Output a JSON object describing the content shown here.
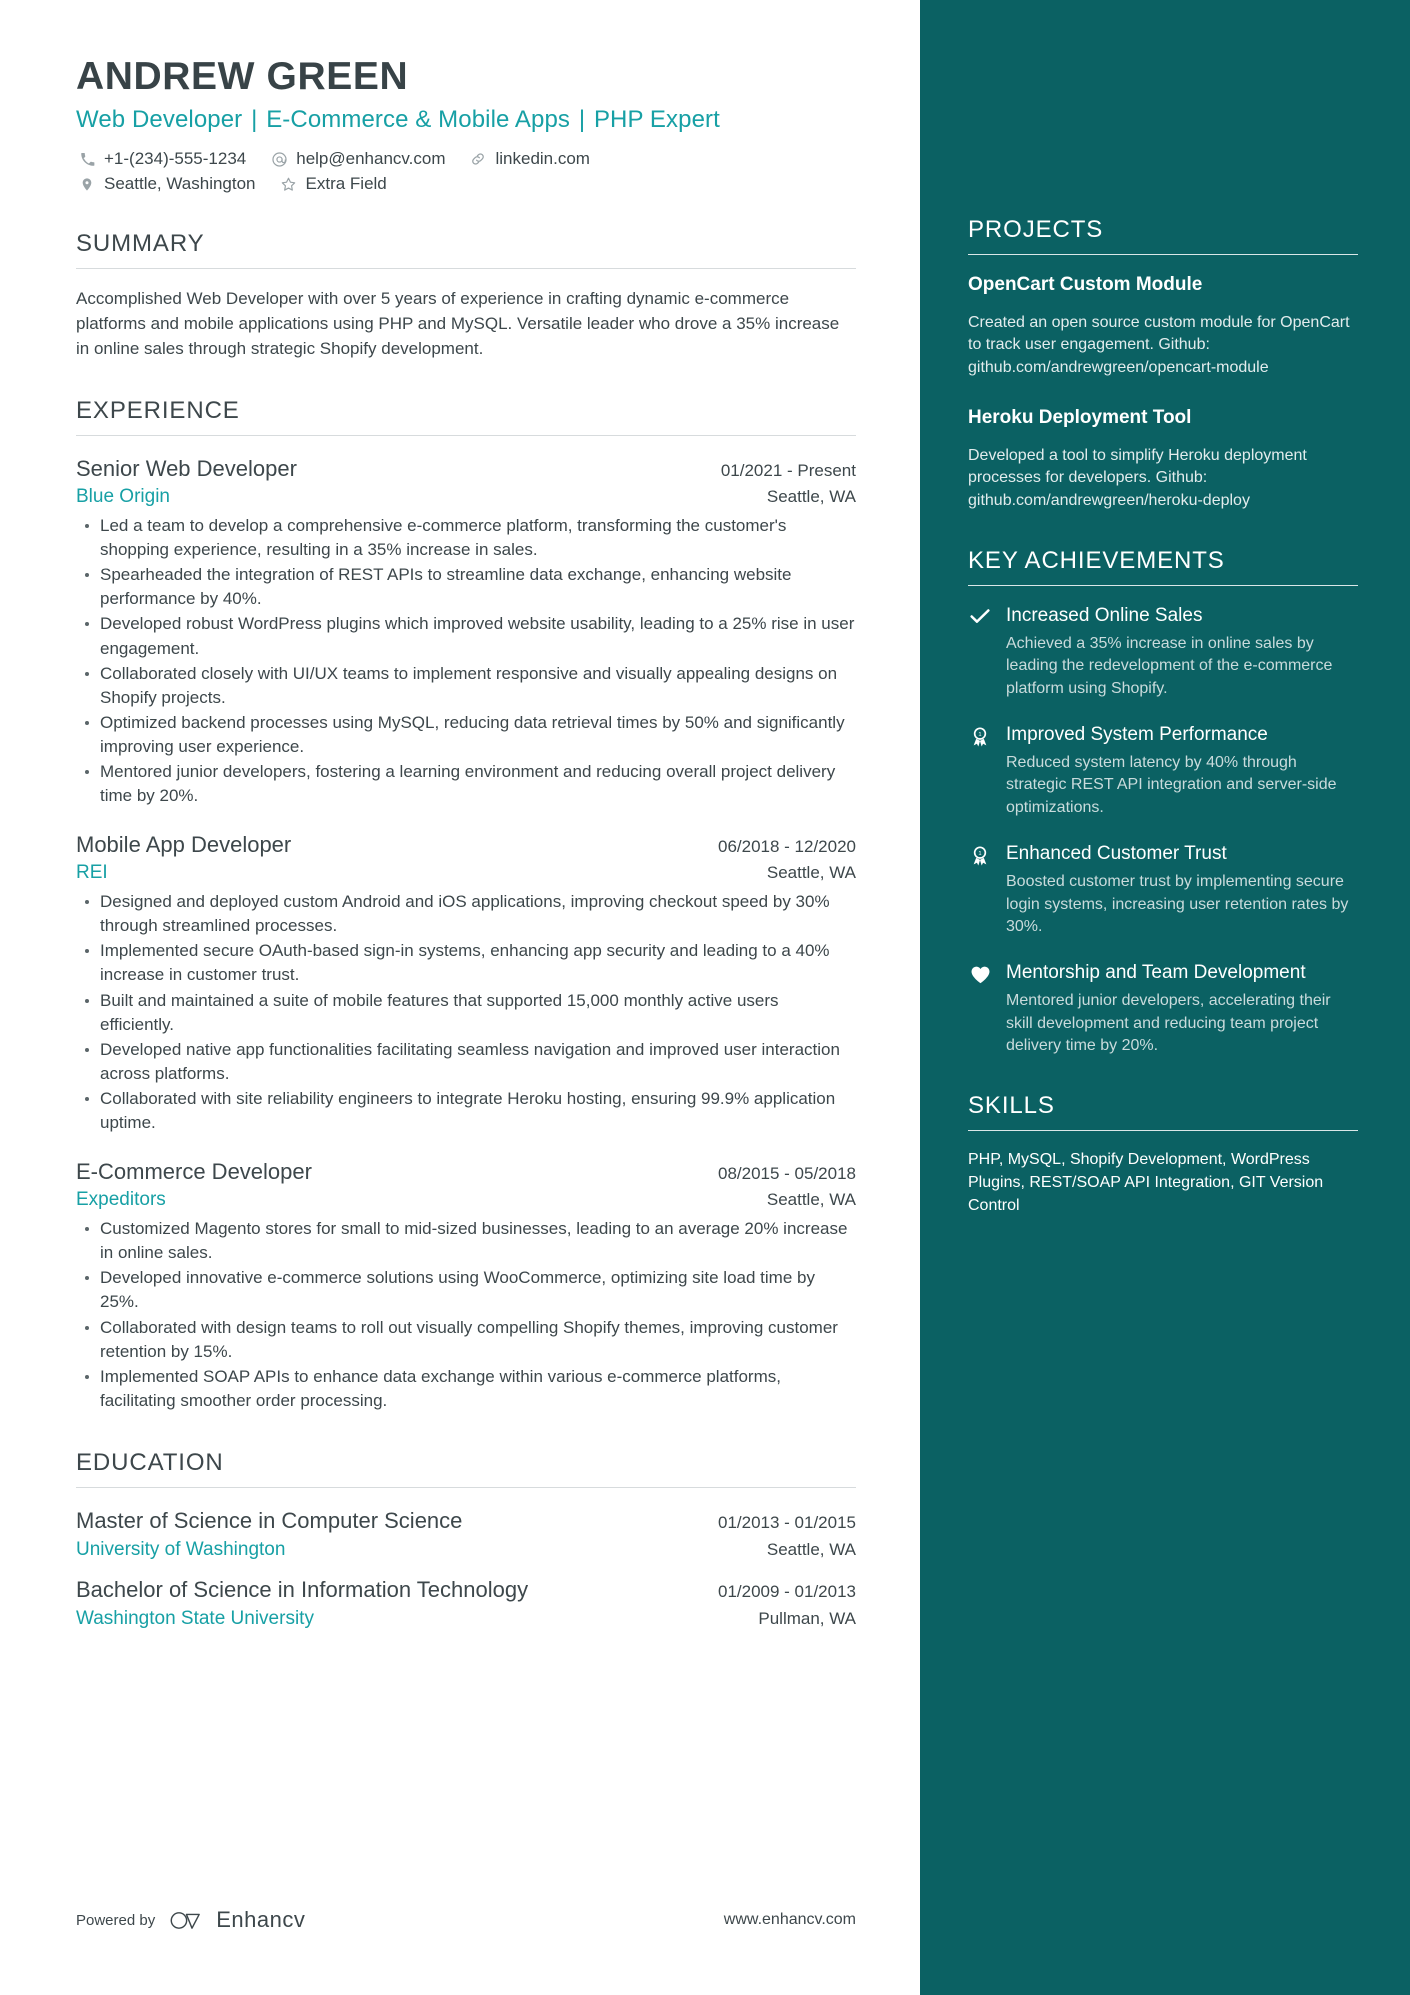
{
  "header": {
    "name": "ANDREW GREEN",
    "headline_parts": [
      "Web Developer",
      "E-Commerce & Mobile Apps",
      "PHP Expert"
    ],
    "separator": "|",
    "contacts_row1": [
      {
        "icon": "phone-icon",
        "text": "+1-(234)-555-1234"
      },
      {
        "icon": "email-icon",
        "text": "help@enhancv.com"
      },
      {
        "icon": "link-icon",
        "text": "linkedin.com"
      }
    ],
    "contacts_row2": [
      {
        "icon": "location-pin-icon",
        "text": "Seattle, Washington"
      },
      {
        "icon": "star-icon",
        "text": "Extra Field"
      }
    ]
  },
  "summary": {
    "title": "SUMMARY",
    "text": "Accomplished Web Developer with over 5 years of experience in crafting dynamic e-commerce platforms and mobile applications using PHP and MySQL. Versatile leader who drove a 35% increase in online sales through strategic Shopify development."
  },
  "experience": {
    "title": "EXPERIENCE",
    "jobs": [
      {
        "title": "Senior Web Developer",
        "dates": "01/2021 - Present",
        "company": "Blue Origin",
        "location": "Seattle, WA",
        "bullets": [
          "Led a team to develop a comprehensive e-commerce platform, transforming the customer's shopping experience, resulting in a 35% increase in sales.",
          "Spearheaded the integration of REST APIs to streamline data exchange, enhancing website performance by 40%.",
          "Developed robust WordPress plugins which improved website usability, leading to a 25% rise in user engagement.",
          "Collaborated closely with UI/UX teams to implement responsive and visually appealing designs on Shopify projects.",
          "Optimized backend processes using MySQL, reducing data retrieval times by 50% and significantly improving user experience.",
          "Mentored junior developers, fostering a learning environment and reducing overall project delivery time by 20%."
        ]
      },
      {
        "title": "Mobile App Developer",
        "dates": "06/2018 - 12/2020",
        "company": "REI",
        "location": "Seattle, WA",
        "bullets": [
          "Designed and deployed custom Android and iOS applications, improving checkout speed by 30% through streamlined processes.",
          "Implemented secure OAuth-based sign-in systems, enhancing app security and leading to a 40% increase in customer trust.",
          "Built and maintained a suite of mobile features that supported 15,000 monthly active users efficiently.",
          "Developed native app functionalities facilitating seamless navigation and improved user interaction across platforms.",
          "Collaborated with site reliability engineers to integrate Heroku hosting, ensuring 99.9% application uptime."
        ]
      },
      {
        "title": "E-Commerce Developer",
        "dates": "08/2015 - 05/2018",
        "company": "Expeditors",
        "location": "Seattle, WA",
        "bullets": [
          "Customized Magento stores for small to mid-sized businesses, leading to an average 20% increase in online sales.",
          "Developed innovative e-commerce solutions using WooCommerce, optimizing site load time by 25%.",
          "Collaborated with design teams to roll out visually compelling Shopify themes, improving customer retention by 15%.",
          "Implemented SOAP APIs to enhance data exchange within various e-commerce platforms, facilitating smoother order processing."
        ]
      }
    ]
  },
  "education": {
    "title": "EDUCATION",
    "entries": [
      {
        "degree": "Master of Science in Computer Science",
        "dates": "01/2013 - 01/2015",
        "school": "University of Washington",
        "location": "Seattle, WA"
      },
      {
        "degree": "Bachelor of Science in Information Technology",
        "dates": "01/2009 - 01/2013",
        "school": "Washington State University",
        "location": "Pullman, WA"
      }
    ]
  },
  "footer": {
    "powered_by": "Powered by",
    "brand": "Enhancv",
    "url": "www.enhancv.com"
  },
  "sidebar": {
    "projects": {
      "title": "PROJECTS",
      "items": [
        {
          "name": "OpenCart Custom Module",
          "description": "Created an open source custom module for OpenCart to track user engagement. Github: github.com/andrewgreen/opencart-module"
        },
        {
          "name": "Heroku Deployment Tool",
          "description": "Developed a tool to simplify Heroku deployment processes for developers. Github: github.com/andrewgreen/heroku-deploy"
        }
      ]
    },
    "achievements": {
      "title": "KEY ACHIEVEMENTS",
      "items": [
        {
          "icon": "check-icon",
          "title": "Increased Online Sales",
          "description": "Achieved a 35% increase in online sales by leading the redevelopment of the e-commerce platform using Shopify."
        },
        {
          "icon": "award-ribbon-icon",
          "title": "Improved System Performance",
          "description": "Reduced system latency by 40% through strategic REST API integration and server-side optimizations."
        },
        {
          "icon": "award-ribbon-icon",
          "title": "Enhanced Customer Trust",
          "description": "Boosted customer trust by implementing secure login systems, increasing user retention rates by 30%."
        },
        {
          "icon": "heart-icon",
          "title": "Mentorship and Team Development",
          "description": "Mentored junior developers, accelerating their skill development and reducing team project delivery time by 20%."
        }
      ]
    },
    "skills": {
      "title": "SKILLS",
      "text": "PHP, MySQL, Shopify Development, WordPress Plugins, REST/SOAP API Integration, GIT Version Control"
    }
  },
  "colors": {
    "accent_teal": "#17a0a5",
    "sidebar_bg": "#0b6163",
    "text_dark": "#3d474b",
    "name_dark": "#384347"
  }
}
